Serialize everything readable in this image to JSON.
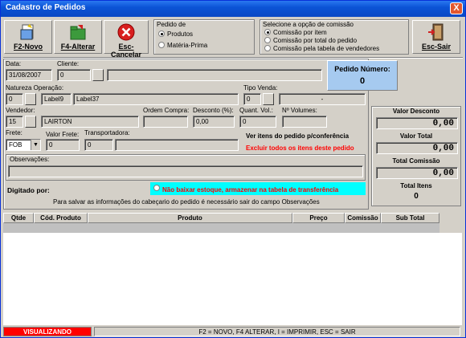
{
  "window": {
    "title": "Cadastro de Pedidos",
    "close": "X"
  },
  "toolbar": {
    "novo": "F2-Novo",
    "alterar": "F4-Alterar",
    "cancelar": "Esc-Cancelar",
    "sair": "Esc-Sair"
  },
  "pedido_de": {
    "title": "Pedido de",
    "options": [
      "Produtos",
      "Matéria-Prima"
    ],
    "selected": "Produtos"
  },
  "comissao": {
    "title": "Selecione a opção de comissão",
    "options": [
      "Comissão por item",
      "Comissão por total do pedido",
      "Comissão pela tabela de vendedores"
    ],
    "selected": "Comissão por item"
  },
  "form": {
    "data_label": "Data:",
    "data_value": "31/08/2007",
    "cliente_label": "Cliente:",
    "cliente_value": "0",
    "natureza_label": "Natureza Operação:",
    "natureza_value": "0",
    "natureza_l1": "Label9",
    "natureza_l2": "Label37",
    "tipo_venda_label": "Tipo Venda:",
    "tipo_venda_value": "0",
    "tipo_venda_desc": "-",
    "vendedor_label": "Vendedor:",
    "vendedor_value": "15",
    "vendedor_name": "LAIRTON",
    "ordem_label": "Ordem Compra:",
    "desconto_label": "Desconto (%):",
    "desconto_value": "0,00",
    "quant_vol_label": "Quant. Vol.:",
    "quant_vol_value": "0",
    "volumes_label": "Nº Volumes:",
    "frete_label": "Frete:",
    "frete_value": "FOB",
    "valor_frete_label": "Valor Frete:",
    "valor_frete_value": "0",
    "transp_label": "Transportadora:",
    "transp_value": "0",
    "obs_label": "Observações:",
    "digitado_label": "Digitado por:",
    "nao_baixar": "Não baixar estoque, armazenar na tabela de transferência",
    "salvar_hint": "Para salvar as informações do cabeçario do pedido é necessário sair do campo Observações",
    "ver_itens": "Ver itens do  pedido p/conferência",
    "excluir": "Excluir todos os itens deste pedido"
  },
  "pedido_numero": {
    "label": "Pedido Número:",
    "value": "0"
  },
  "totals": {
    "desconto_label": "Valor Desconto",
    "desconto_value": "0,00",
    "total_label": "Valor Total",
    "total_value": "0,00",
    "comissao_label": "Total Comissão",
    "comissao_value": "0,00",
    "itens_label": "Total Itens",
    "itens_value": "0"
  },
  "grid": {
    "columns": [
      "Qtde",
      "Cód. Produto",
      "Produto",
      "Preço",
      "Comissão",
      "Sub Total"
    ]
  },
  "status": {
    "mode": "VISUALIZANDO",
    "shortcuts": "F2 = NOVO, F4  ALTERAR, I = IMPRIMIR, ESC = SAIR"
  },
  "colors": {
    "mode_bg": "#ff0000",
    "link_red": "#ff0000",
    "cyan_panel": "#00ffff",
    "pedido_box": "#a6caf0"
  }
}
